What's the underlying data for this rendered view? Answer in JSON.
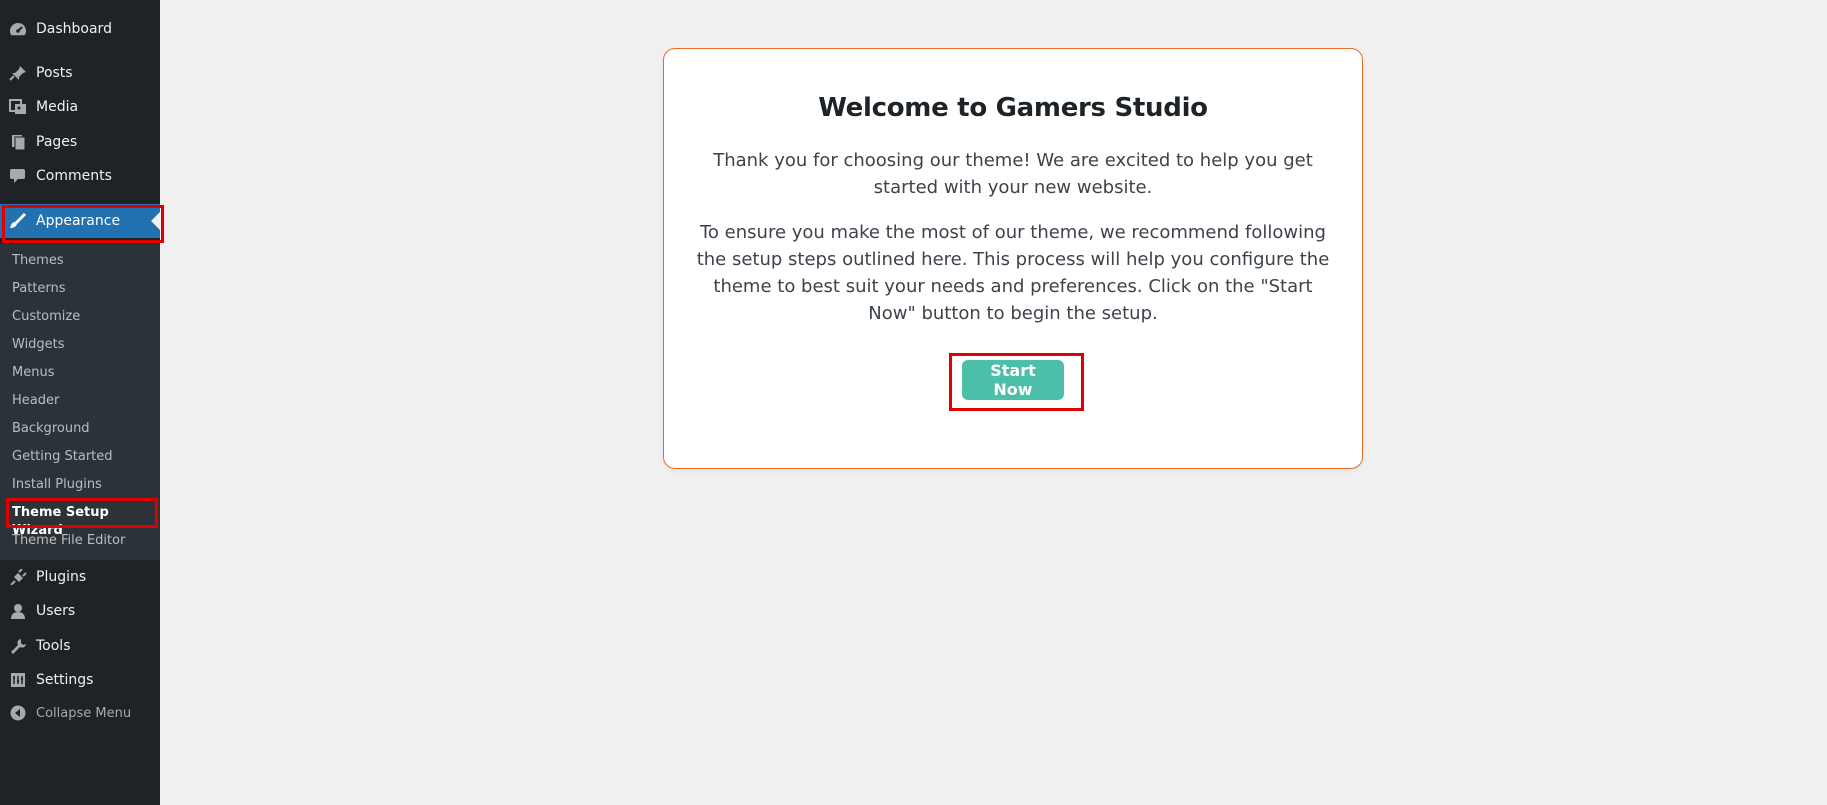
{
  "sidebar": {
    "top_items": [
      {
        "label": "Dashboard",
        "icon": "dashboard-icon"
      },
      {
        "label": "Posts",
        "icon": "pushpin-icon"
      },
      {
        "label": "Media",
        "icon": "media-icon"
      },
      {
        "label": "Pages",
        "icon": "pages-icon"
      },
      {
        "label": "Comments",
        "icon": "comment-icon"
      }
    ],
    "appearance": {
      "label": "Appearance",
      "icon": "paintbrush-icon"
    },
    "submenu": [
      "Themes",
      "Patterns",
      "Customize",
      "Widgets",
      "Menus",
      "Header",
      "Background",
      "Getting Started",
      "Install Plugins",
      "Theme Setup Wizard",
      "Theme File Editor"
    ],
    "current_submenu": "Theme Setup Wizard",
    "bottom_items": [
      {
        "label": "Plugins",
        "icon": "plugin-icon"
      },
      {
        "label": "Users",
        "icon": "user-icon"
      },
      {
        "label": "Tools",
        "icon": "wrench-icon"
      },
      {
        "label": "Settings",
        "icon": "settings-icon"
      }
    ],
    "collapse": {
      "label": "Collapse Menu",
      "icon": "collapse-icon"
    }
  },
  "card": {
    "title": "Welcome to Gamers Studio",
    "paragraph1": "Thank you for choosing our theme! We are excited to help you get started with your new website.",
    "paragraph2": "To ensure you make the most of our theme, we recommend following the setup steps outlined here. This process will help you configure the theme to best suit your needs and preferences. Click on the \"Start Now\" button to begin the setup.",
    "button_label": "Start Now"
  },
  "colors": {
    "sidebar_bg": "#1d2327",
    "submenu_bg": "#2c3338",
    "active_bg": "#2271b1",
    "highlight_red": "#e00000",
    "card_border": "#e86d26",
    "button_bg": "#4bbfa8"
  }
}
